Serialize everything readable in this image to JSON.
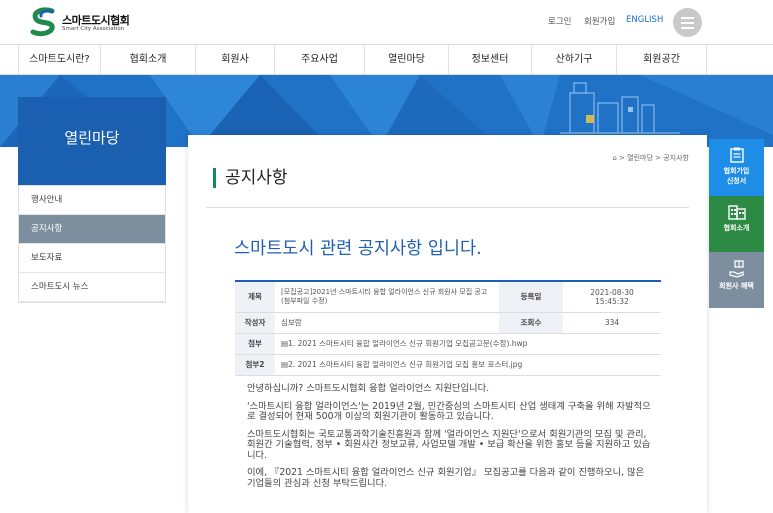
{
  "header": {
    "logo_title": "스마트도시협회",
    "logo_sub": "Smart City Association",
    "login": "로그인",
    "join": "회원가입",
    "english": "ENGLISH"
  },
  "gnb": [
    "스마트도시란?",
    "협회소개",
    "회원사",
    "주요사업",
    "열린마당",
    "정보센터",
    "산하기구",
    "회원공간"
  ],
  "lnb": {
    "title": "열린마당",
    "items": [
      "행사안내",
      "공지사항",
      "보도자료",
      "스마트도시 뉴스"
    ]
  },
  "breadcrumb": "⌂ > 열린마당 > 공지사항",
  "page_title": "공지사항",
  "notice_title": "스마트도시 관련 공지사항 입니다.",
  "post": {
    "subject_label": "제목",
    "subject": "[모집공고]2021년 스마트시티 융합 얼라이언스 신규 회원사 모집 공고(첨부파일 수정)",
    "date_label": "등록일",
    "date": "2021-08-30",
    "time": "15:45:32",
    "author_label": "작성자",
    "author": "심보람",
    "views_label": "조회수",
    "views": "334",
    "attach_label": "첨부",
    "attach": "1. 2021 스마트시티 융합 얼라이언스 신규 회원기업 모집공고문(수정).hwp",
    "attach2_label": "첨부2",
    "attach2": "2. 2021 스마트시티 융합 얼라이언스 신규 회원기업 모집 홍보 포스터.jpg"
  },
  "body": [
    "안녕하십니까? 스마트도시협회 융합 얼라이언스 지원단입니다.",
    "'스마트시티 융합 얼라이언스'는 2019년 2월, 민간중심의 스마트시티 산업 생태계 구축을 위해 자발적으로 결성되어 현재 500개 이상의 회원기관이 활동하고 있습니다.",
    "스마트도시협회는 국토교통과학기술진흥원과 함께 '얼라이언스 지원단'으로서 회원기관의 모집 및 관리, 회원간 기술협력, 정부 • 회원사간 정보교류, 사업모델 개발 • 보급 확산을 위한 홍보 등을 지원하고 있습니다.",
    "이에, 『2021 스마트시티 융합 얼라이언스 신규 회원기업』 모집공고를 다음과 같이 진행하오니, 많은 기업들의 관심과 신청 부탁드립니다."
  ],
  "quick": {
    "join_line1": "협회가입",
    "join_line2": "신청서",
    "about": "협회소개",
    "benefit": "회원사 혜택"
  },
  "colors": {
    "primary": "#1b5fb0",
    "banner": "#1f72c6",
    "accent_green": "#0f8a5a",
    "quick_blue": "#1e8de8",
    "quick_green": "#2d8a44",
    "quick_gray": "#7d8f9e"
  }
}
